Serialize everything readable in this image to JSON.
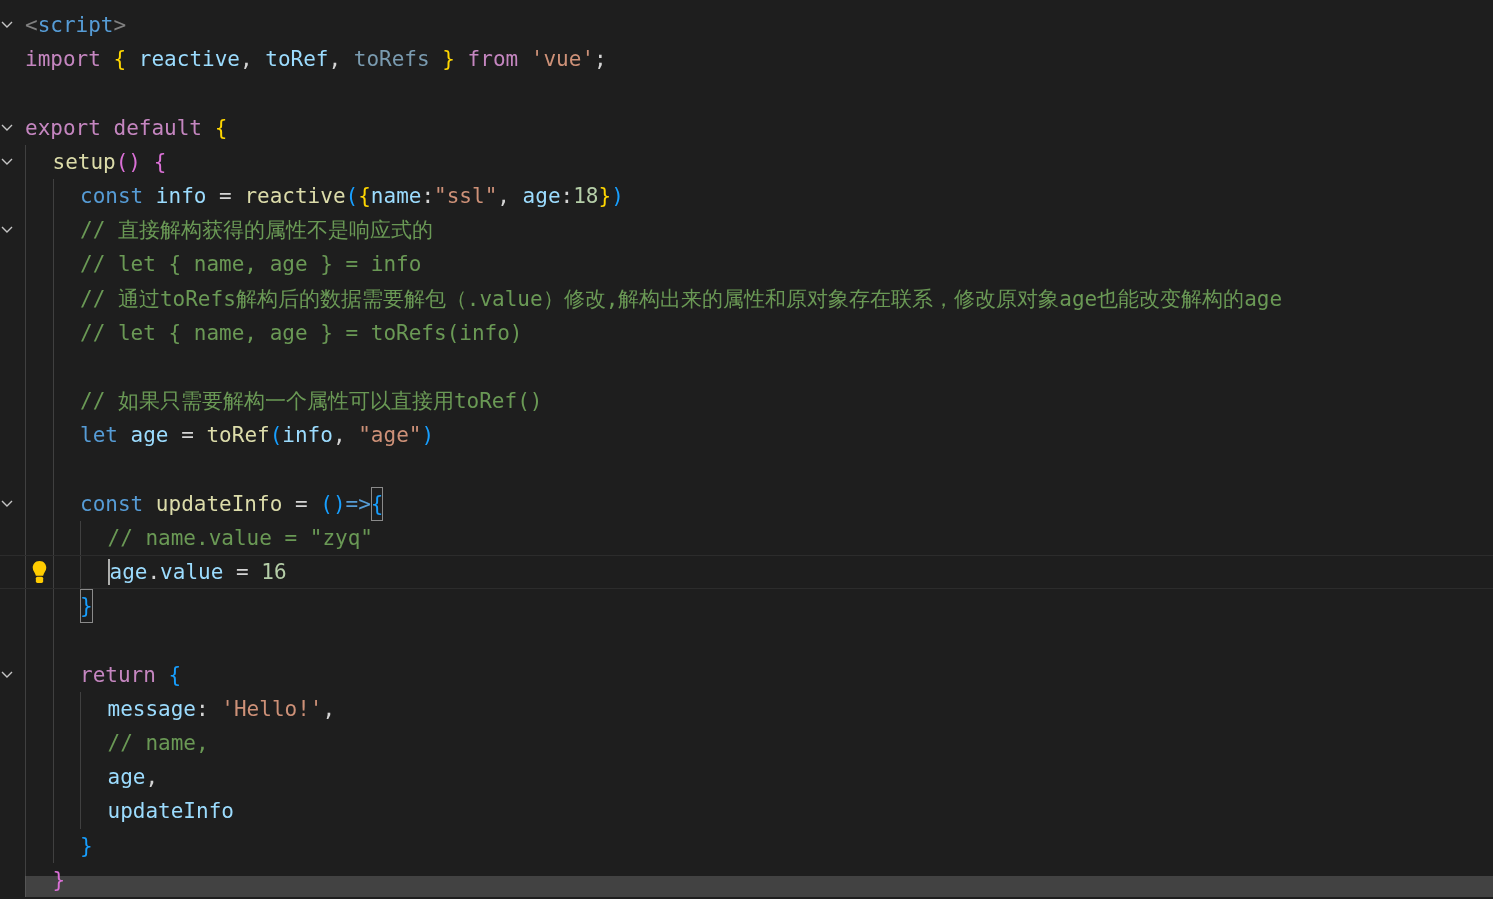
{
  "editor": {
    "lines": [
      {
        "fold": true,
        "current": false,
        "tokens": [
          {
            "kind": "tag-bracket",
            "text": "<"
          },
          {
            "kind": "tag",
            "text": "script"
          },
          {
            "kind": "tag-bracket",
            "text": ">"
          }
        ]
      },
      {
        "fold": false,
        "current": false,
        "tokens": [
          {
            "kind": "keyword",
            "text": "import "
          },
          {
            "kind": "brace-yellow",
            "text": "{ "
          },
          {
            "kind": "variable",
            "text": "reactive"
          },
          {
            "kind": "punct",
            "text": ", "
          },
          {
            "kind": "variable",
            "text": "toRef"
          },
          {
            "kind": "punct",
            "text": ", "
          },
          {
            "kind": "unused",
            "text": "toRefs "
          },
          {
            "kind": "brace-yellow",
            "text": "} "
          },
          {
            "kind": "keyword",
            "text": "from "
          },
          {
            "kind": "string",
            "text": "'vue'"
          },
          {
            "kind": "punct",
            "text": ";"
          }
        ]
      },
      {
        "fold": false,
        "current": false
      },
      {
        "fold": true,
        "current": false,
        "tokens": [
          {
            "kind": "keyword",
            "text": "export default "
          },
          {
            "kind": "brace-yellow",
            "text": "{"
          }
        ],
        "children": [
          {
            "fold": true,
            "current": false,
            "tokens": [
              {
                "kind": "function",
                "text": "setup"
              },
              {
                "kind": "brace-pink",
                "text": "() {"
              }
            ],
            "children": [
              {
                "fold": false,
                "current": false,
                "tokens": [
                  {
                    "kind": "storage",
                    "text": "const "
                  },
                  {
                    "kind": "variable",
                    "text": "info "
                  },
                  {
                    "kind": "punct",
                    "text": "= "
                  },
                  {
                    "kind": "function",
                    "text": "reactive"
                  },
                  {
                    "kind": "brace-blue",
                    "text": "("
                  },
                  {
                    "kind": "brace-yellow",
                    "text": "{"
                  },
                  {
                    "kind": "variable",
                    "text": "name"
                  },
                  {
                    "kind": "punct",
                    "text": ":"
                  },
                  {
                    "kind": "string",
                    "text": "\"ssl\""
                  },
                  {
                    "kind": "punct",
                    "text": ", "
                  },
                  {
                    "kind": "variable",
                    "text": "age"
                  },
                  {
                    "kind": "punct",
                    "text": ":"
                  },
                  {
                    "kind": "number",
                    "text": "18"
                  },
                  {
                    "kind": "brace-yellow",
                    "text": "}"
                  },
                  {
                    "kind": "brace-blue",
                    "text": ")"
                  }
                ]
              },
              {
                "fold": true,
                "current": false,
                "tokens": [
                  {
                    "kind": "comment",
                    "text": "// 直接解构获得的属性不是响应式的"
                  }
                ]
              },
              {
                "fold": false,
                "current": false,
                "tokens": [
                  {
                    "kind": "comment",
                    "text": "// let { name, age } = info"
                  }
                ]
              },
              {
                "fold": false,
                "current": false,
                "tokens": [
                  {
                    "kind": "comment",
                    "text": "// 通过toRefs解构后的数据需要解包（.value）修改,解构出来的属性和原对象存在联系，修改原对象age也能改变解构的age"
                  }
                ]
              },
              {
                "fold": false,
                "current": false,
                "tokens": [
                  {
                    "kind": "comment",
                    "text": "// let { name, age } = toRefs(info)"
                  }
                ]
              },
              {
                "fold": false,
                "current": false
              },
              {
                "fold": false,
                "current": false,
                "tokens": [
                  {
                    "kind": "comment",
                    "text": "// 如果只需要解构一个属性可以直接用toRef()"
                  }
                ]
              },
              {
                "fold": false,
                "current": false,
                "tokens": [
                  {
                    "kind": "storage",
                    "text": "let "
                  },
                  {
                    "kind": "variable",
                    "text": "age "
                  },
                  {
                    "kind": "punct",
                    "text": "= "
                  },
                  {
                    "kind": "function",
                    "text": "toRef"
                  },
                  {
                    "kind": "brace-blue",
                    "text": "("
                  },
                  {
                    "kind": "variable",
                    "text": "info"
                  },
                  {
                    "kind": "punct",
                    "text": ", "
                  },
                  {
                    "kind": "string",
                    "text": "\"age\""
                  },
                  {
                    "kind": "brace-blue",
                    "text": ")"
                  }
                ]
              },
              {
                "fold": false,
                "current": false
              },
              {
                "fold": true,
                "current": false,
                "tokens": [
                  {
                    "kind": "storage",
                    "text": "const "
                  },
                  {
                    "kind": "function",
                    "text": "updateInfo "
                  },
                  {
                    "kind": "punct",
                    "text": "= "
                  },
                  {
                    "kind": "brace-blue",
                    "text": "()"
                  },
                  {
                    "kind": "storage",
                    "text": "=>"
                  },
                  {
                    "kind": "brace-blue",
                    "text": "{",
                    "matched": true
                  }
                ],
                "children": [
                  {
                    "fold": false,
                    "current": false,
                    "tokens": [
                      {
                        "kind": "comment",
                        "text": "// name.value = \"zyq\""
                      }
                    ]
                  },
                  {
                    "fold": false,
                    "current": true,
                    "tokens": [
                      {
                        "kind": "variable",
                        "text": "age"
                      },
                      {
                        "kind": "punct",
                        "text": "."
                      },
                      {
                        "kind": "variable",
                        "text": "value "
                      },
                      {
                        "kind": "punct",
                        "text": "= "
                      },
                      {
                        "kind": "number",
                        "text": "16"
                      }
                    ]
                  }
                ]
              },
              {
                "fold": false,
                "current": false,
                "tokens": [
                  {
                    "kind": "brace-blue",
                    "text": "}",
                    "matched": true
                  }
                ]
              },
              {
                "fold": false,
                "current": false
              },
              {
                "fold": true,
                "current": false,
                "tokens": [
                  {
                    "kind": "keyword",
                    "text": "return "
                  },
                  {
                    "kind": "brace-blue",
                    "text": "{"
                  }
                ],
                "children": [
                  {
                    "fold": false,
                    "current": false,
                    "tokens": [
                      {
                        "kind": "variable",
                        "text": "message"
                      },
                      {
                        "kind": "punct",
                        "text": ": "
                      },
                      {
                        "kind": "string",
                        "text": "'Hello!'"
                      },
                      {
                        "kind": "punct",
                        "text": ","
                      }
                    ]
                  },
                  {
                    "fold": false,
                    "current": false,
                    "tokens": [
                      {
                        "kind": "comment",
                        "text": "// name,"
                      }
                    ]
                  },
                  {
                    "fold": false,
                    "current": false,
                    "tokens": [
                      {
                        "kind": "variable",
                        "text": "age"
                      },
                      {
                        "kind": "punct",
                        "text": ","
                      }
                    ]
                  },
                  {
                    "fold": false,
                    "current": false,
                    "tokens": [
                      {
                        "kind": "variable",
                        "text": "updateInfo"
                      }
                    ]
                  }
                ]
              },
              {
                "fold": false,
                "current": false,
                "tokens": [
                  {
                    "kind": "brace-blue",
                    "text": "}"
                  }
                ]
              }
            ]
          },
          {
            "fold": false,
            "current": false,
            "tokens": [
              {
                "kind": "brace-pink",
                "text": "}"
              }
            ]
          }
        ]
      }
    ]
  }
}
